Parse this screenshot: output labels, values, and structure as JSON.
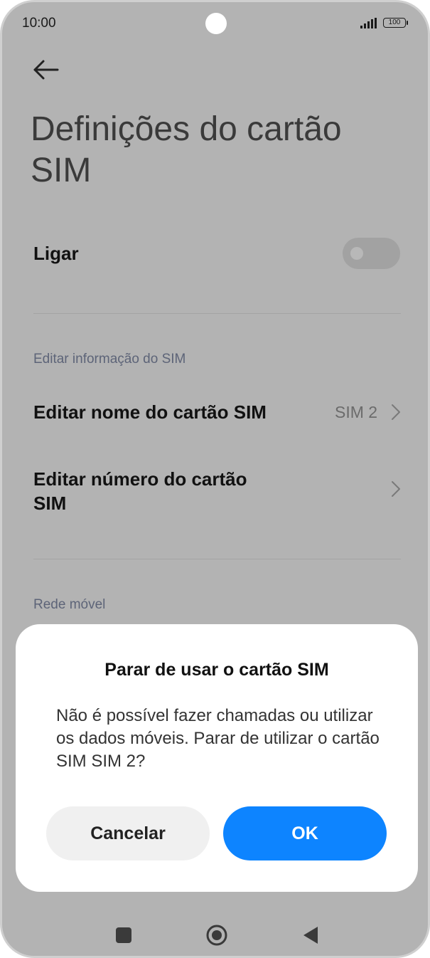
{
  "status_bar": {
    "time": "10:00",
    "battery": "100",
    "signal_icon": "signal-bars-icon"
  },
  "header": {
    "back_icon": "back-arrow-icon",
    "title": "Definições do cartão SIM"
  },
  "settings": {
    "toggle_row": {
      "label": "Ligar",
      "enabled": false
    },
    "section_edit": {
      "header": "Editar informação do SIM",
      "items": [
        {
          "label": "Editar nome do cartão SIM",
          "value": "SIM 2"
        },
        {
          "label": "Editar número do cartão SIM",
          "value": ""
        }
      ]
    },
    "section_network": {
      "header": "Rede móvel"
    }
  },
  "dialog": {
    "title": "Parar de usar o cartão SIM",
    "message": "Não é possível fazer chamadas ou utilizar os dados móveis. Parar de utilizar o cartão SIM SIM 2?",
    "cancel_label": "Cancelar",
    "ok_label": "OK"
  },
  "colors": {
    "overlay_background": "#b3b3b3",
    "accent": "#0d84ff",
    "dialog_background": "#ffffff"
  },
  "nav_bar": {
    "recents_icon": "square-recents-icon",
    "home_icon": "circle-home-icon",
    "back_icon": "triangle-back-icon"
  }
}
